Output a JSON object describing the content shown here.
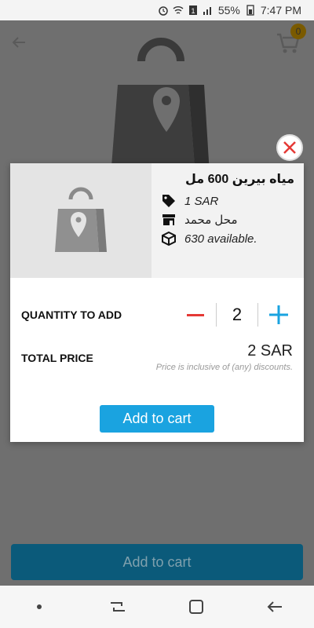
{
  "status_bar": {
    "battery": "55%",
    "time": "7:47 PM"
  },
  "app_bar": {
    "cart_count": "0"
  },
  "modal": {
    "product_name": "مياه بيرين 600 مل",
    "price": "1 SAR",
    "store": "محل محمد",
    "availability": "630 available.",
    "quantity_label": "QUANTITY TO ADD",
    "quantity": "2",
    "total_label": "TOTAL PRICE",
    "total_price": "2 SAR",
    "price_note": "Price is inclusive of (any) discounts.",
    "add_button": "Add to cart"
  },
  "page": {
    "bottom_add_button": "Add to cart"
  },
  "colors": {
    "accent": "#1aa3e0",
    "minus": "#e53935",
    "close": "#e53935"
  },
  "icons": [
    "back-arrow-icon",
    "cart-icon",
    "price-tag-icon",
    "store-icon",
    "box-icon",
    "minus-icon",
    "plus-icon",
    "close-icon",
    "shopping-bag-icon"
  ]
}
